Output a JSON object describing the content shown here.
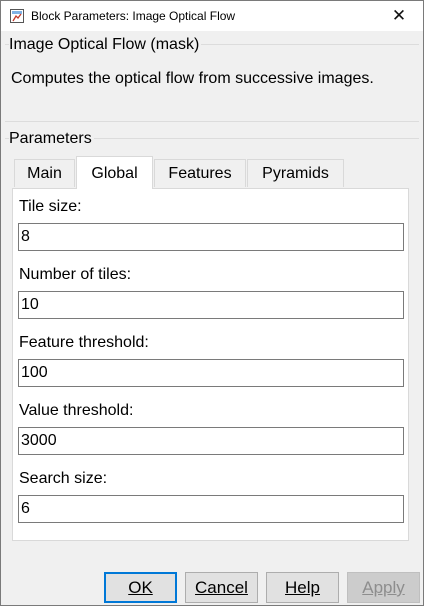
{
  "window": {
    "title": "Block Parameters: Image Optical Flow",
    "icon": "simulink-block-icon",
    "close_symbol": "✕"
  },
  "mask": {
    "heading": "Image Optical Flow (mask)",
    "description": "Computes the optical flow from successive images."
  },
  "parameters": {
    "heading": "Parameters",
    "tabs": [
      {
        "label": "Main",
        "active": false
      },
      {
        "label": "Global",
        "active": true
      },
      {
        "label": "Features",
        "active": false
      },
      {
        "label": "Pyramids",
        "active": false
      }
    ],
    "fields": [
      {
        "label": "Tile size:",
        "value": "8"
      },
      {
        "label": "Number of tiles:",
        "value": "10"
      },
      {
        "label": "Feature threshold:",
        "value": "100"
      },
      {
        "label": "Value threshold:",
        "value": "3000"
      },
      {
        "label": "Search size:",
        "value": "6"
      }
    ]
  },
  "buttons": {
    "ok": "OK",
    "cancel": "Cancel",
    "help": "Help",
    "apply": "Apply"
  },
  "colors": {
    "focus_border": "#0078d7",
    "window_bg": "#f0f0f0",
    "panel_bg": "#ffffff"
  }
}
